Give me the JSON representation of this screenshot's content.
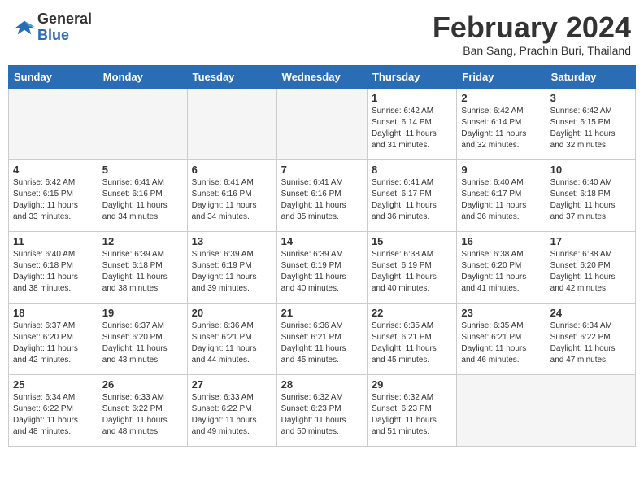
{
  "header": {
    "logo_general": "General",
    "logo_blue": "Blue",
    "month_title": "February 2024",
    "location": "Ban Sang, Prachin Buri, Thailand"
  },
  "weekdays": [
    "Sunday",
    "Monday",
    "Tuesday",
    "Wednesday",
    "Thursday",
    "Friday",
    "Saturday"
  ],
  "weeks": [
    [
      {
        "day": "",
        "info": ""
      },
      {
        "day": "",
        "info": ""
      },
      {
        "day": "",
        "info": ""
      },
      {
        "day": "",
        "info": ""
      },
      {
        "day": "1",
        "info": "Sunrise: 6:42 AM\nSunset: 6:14 PM\nDaylight: 11 hours\nand 31 minutes."
      },
      {
        "day": "2",
        "info": "Sunrise: 6:42 AM\nSunset: 6:14 PM\nDaylight: 11 hours\nand 32 minutes."
      },
      {
        "day": "3",
        "info": "Sunrise: 6:42 AM\nSunset: 6:15 PM\nDaylight: 11 hours\nand 32 minutes."
      }
    ],
    [
      {
        "day": "4",
        "info": "Sunrise: 6:42 AM\nSunset: 6:15 PM\nDaylight: 11 hours\nand 33 minutes."
      },
      {
        "day": "5",
        "info": "Sunrise: 6:41 AM\nSunset: 6:16 PM\nDaylight: 11 hours\nand 34 minutes."
      },
      {
        "day": "6",
        "info": "Sunrise: 6:41 AM\nSunset: 6:16 PM\nDaylight: 11 hours\nand 34 minutes."
      },
      {
        "day": "7",
        "info": "Sunrise: 6:41 AM\nSunset: 6:16 PM\nDaylight: 11 hours\nand 35 minutes."
      },
      {
        "day": "8",
        "info": "Sunrise: 6:41 AM\nSunset: 6:17 PM\nDaylight: 11 hours\nand 36 minutes."
      },
      {
        "day": "9",
        "info": "Sunrise: 6:40 AM\nSunset: 6:17 PM\nDaylight: 11 hours\nand 36 minutes."
      },
      {
        "day": "10",
        "info": "Sunrise: 6:40 AM\nSunset: 6:18 PM\nDaylight: 11 hours\nand 37 minutes."
      }
    ],
    [
      {
        "day": "11",
        "info": "Sunrise: 6:40 AM\nSunset: 6:18 PM\nDaylight: 11 hours\nand 38 minutes."
      },
      {
        "day": "12",
        "info": "Sunrise: 6:39 AM\nSunset: 6:18 PM\nDaylight: 11 hours\nand 38 minutes."
      },
      {
        "day": "13",
        "info": "Sunrise: 6:39 AM\nSunset: 6:19 PM\nDaylight: 11 hours\nand 39 minutes."
      },
      {
        "day": "14",
        "info": "Sunrise: 6:39 AM\nSunset: 6:19 PM\nDaylight: 11 hours\nand 40 minutes."
      },
      {
        "day": "15",
        "info": "Sunrise: 6:38 AM\nSunset: 6:19 PM\nDaylight: 11 hours\nand 40 minutes."
      },
      {
        "day": "16",
        "info": "Sunrise: 6:38 AM\nSunset: 6:20 PM\nDaylight: 11 hours\nand 41 minutes."
      },
      {
        "day": "17",
        "info": "Sunrise: 6:38 AM\nSunset: 6:20 PM\nDaylight: 11 hours\nand 42 minutes."
      }
    ],
    [
      {
        "day": "18",
        "info": "Sunrise: 6:37 AM\nSunset: 6:20 PM\nDaylight: 11 hours\nand 42 minutes."
      },
      {
        "day": "19",
        "info": "Sunrise: 6:37 AM\nSunset: 6:20 PM\nDaylight: 11 hours\nand 43 minutes."
      },
      {
        "day": "20",
        "info": "Sunrise: 6:36 AM\nSunset: 6:21 PM\nDaylight: 11 hours\nand 44 minutes."
      },
      {
        "day": "21",
        "info": "Sunrise: 6:36 AM\nSunset: 6:21 PM\nDaylight: 11 hours\nand 45 minutes."
      },
      {
        "day": "22",
        "info": "Sunrise: 6:35 AM\nSunset: 6:21 PM\nDaylight: 11 hours\nand 45 minutes."
      },
      {
        "day": "23",
        "info": "Sunrise: 6:35 AM\nSunset: 6:21 PM\nDaylight: 11 hours\nand 46 minutes."
      },
      {
        "day": "24",
        "info": "Sunrise: 6:34 AM\nSunset: 6:22 PM\nDaylight: 11 hours\nand 47 minutes."
      }
    ],
    [
      {
        "day": "25",
        "info": "Sunrise: 6:34 AM\nSunset: 6:22 PM\nDaylight: 11 hours\nand 48 minutes."
      },
      {
        "day": "26",
        "info": "Sunrise: 6:33 AM\nSunset: 6:22 PM\nDaylight: 11 hours\nand 48 minutes."
      },
      {
        "day": "27",
        "info": "Sunrise: 6:33 AM\nSunset: 6:22 PM\nDaylight: 11 hours\nand 49 minutes."
      },
      {
        "day": "28",
        "info": "Sunrise: 6:32 AM\nSunset: 6:23 PM\nDaylight: 11 hours\nand 50 minutes."
      },
      {
        "day": "29",
        "info": "Sunrise: 6:32 AM\nSunset: 6:23 PM\nDaylight: 11 hours\nand 51 minutes."
      },
      {
        "day": "",
        "info": ""
      },
      {
        "day": "",
        "info": ""
      }
    ]
  ]
}
